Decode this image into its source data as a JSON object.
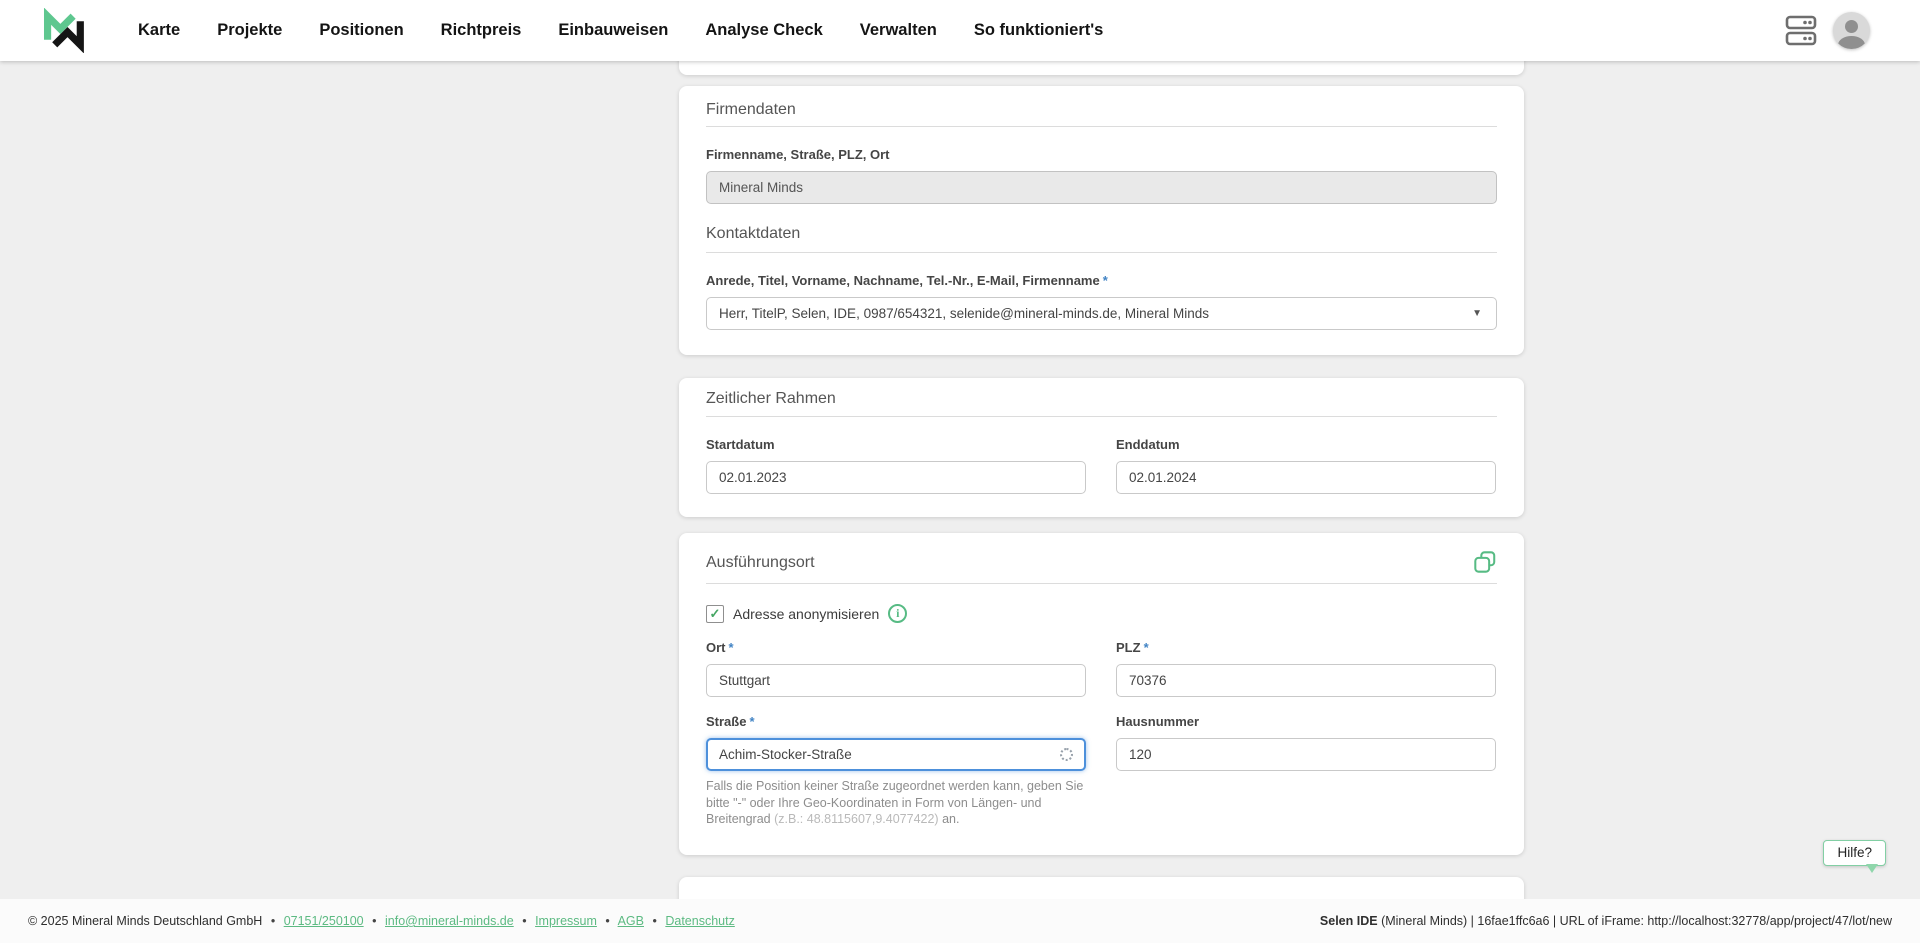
{
  "header": {
    "nav": {
      "items": [
        {
          "label": "Karte"
        },
        {
          "label": "Projekte"
        },
        {
          "label": "Positionen"
        },
        {
          "label": "Richtpreis"
        },
        {
          "label": "Einbauweisen"
        },
        {
          "label": "Analyse Check"
        },
        {
          "label": "Verwalten"
        },
        {
          "label": "So funktioniert's"
        }
      ]
    }
  },
  "icons": {
    "checkmark": "✓",
    "info": "i",
    "caret": "▼"
  },
  "colors": {
    "accent_green": "#57bb84",
    "link_green": "#5cba82",
    "required_blue": "#4183c4",
    "focus_blue": "#4d90db",
    "page_background": "#efefef"
  },
  "sections": {
    "firmendaten": {
      "title": "Firmendaten",
      "field_label": "Firmenname, Straße, PLZ, Ort",
      "company_value": "Mineral Minds"
    },
    "kontaktdaten": {
      "title": "Kontaktdaten",
      "field_label": "Anrede, Titel, Vorname, Nachname, Tel.-Nr., E-Mail, Firmenname",
      "required_mark": "*",
      "selected_contact": "Herr, TitelP, Selen, IDE, 0987/654321, selenide@mineral-minds.de, Mineral Minds"
    },
    "zeitlicher_rahmen": {
      "title": "Zeitlicher Rahmen",
      "start_label": "Startdatum",
      "start_value": "02.01.2023",
      "end_label": "Enddatum",
      "end_value": "02.01.2024"
    },
    "ausfuehrungsort": {
      "title": "Ausführungsort",
      "anonymize_label": "Adresse anonymisieren",
      "required_mark": "*",
      "ort_label": "Ort",
      "ort_value": "Stuttgart",
      "plz_label": "PLZ",
      "plz_value": "70376",
      "strasse_label": "Straße",
      "strasse_value": "Achim-Stocker-Straße",
      "hausnummer_label": "Hausnummer",
      "hausnummer_value": "120",
      "helper_pre": "Falls die Position keiner Straße zugeordnet werden kann, geben Sie bitte \"-\" oder Ihre Geo-Koordinaten in Form von Längen- und Breitengrad ",
      "helper_example": "(z.B.: 48.8115607,9.4077422)",
      "helper_post": " an."
    }
  },
  "help": {
    "label": "Hilfe?"
  },
  "footer": {
    "copyright": "© 2025 Mineral Minds Deutschland GmbH",
    "separator": "•",
    "phone": "07151/250100",
    "email": "info@mineral-minds.de",
    "impressum": "Impressum",
    "agb": "AGB",
    "datenschutz": "Datenschutz",
    "right_bold": "Selen IDE",
    "right_rest": " (Mineral Minds) | 16fae1ffc6a6 | URL of iFrame: http://localhost:32778/app/project/47/lot/new"
  }
}
